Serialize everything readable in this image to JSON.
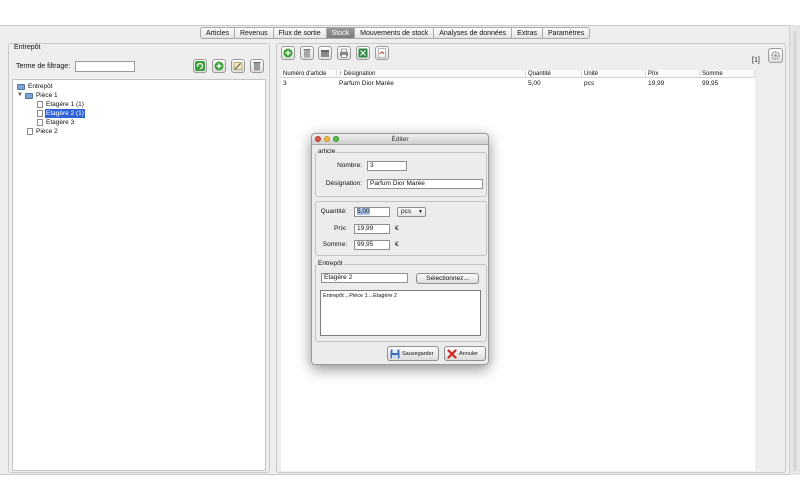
{
  "tabs": [
    "Articles",
    "Revenus",
    "Flux de sortie",
    "Stock",
    "Mouvements de stock",
    "Analyses de données",
    "Extras",
    "Paramètres"
  ],
  "active_tab": "Stock",
  "left": {
    "legend": "Entrepôt",
    "filter_label": "Terme de filtrage:",
    "filter_value": "",
    "tree": [
      {
        "label": "Entrepôt",
        "type": "folder"
      },
      {
        "label": "Pièce 1",
        "type": "folder",
        "expanded": true
      },
      {
        "label": "Etagère 1 (1)",
        "type": "doc"
      },
      {
        "label": "Etagère 2 (1)",
        "type": "doc",
        "selected": true
      },
      {
        "label": "Etagère 3",
        "type": "doc"
      },
      {
        "label": "Pièce 2",
        "type": "doc"
      }
    ]
  },
  "table": {
    "count": "[1]",
    "headers": [
      "Numéro d'article",
      "↑ Désignation",
      "Quantité",
      "Unité",
      "Prix",
      "Somme"
    ],
    "rows": [
      [
        "3",
        "Parfum Dior Marée",
        "5,00",
        "pcs",
        "19,99",
        "99,95"
      ]
    ]
  },
  "dialog": {
    "title": "Éditer",
    "article_legend": "article",
    "nombre_label": "Nombre:",
    "nombre_value": "3",
    "designation_label": "Désignation:",
    "designation_value": "Parfum Dior Marée",
    "quantite_label": "Quantité:",
    "quantite_value": "5,00",
    "unit_value": "pcs",
    "prix_label": "Prix:",
    "prix_value": "19,99",
    "prix_currency": "€",
    "somme_label": "Somme:",
    "somme_value": "99,95",
    "somme_currency": "€",
    "entrepot_legend": "Entrepôt",
    "entrepot_value": "Etagère 2",
    "select_button": "Sélectionnez...",
    "path_text": "Entrepôt→Pièce 1→Etagère 2",
    "save_button": "Sauvegarder",
    "cancel_button": "Annuler"
  },
  "colors": {
    "selection": "#2f62d6",
    "window_bg": "#eeeeee"
  }
}
